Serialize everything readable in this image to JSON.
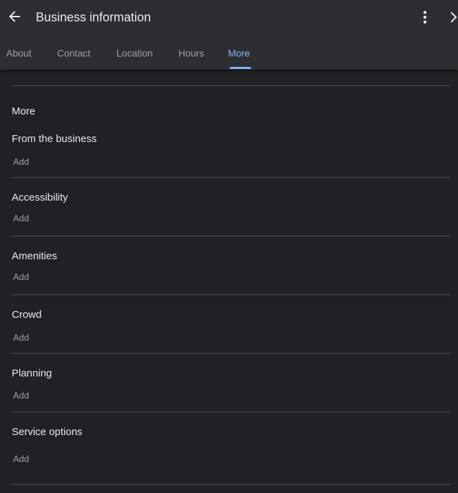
{
  "header": {
    "title": "Business information",
    "back_icon": "arrow-left-icon",
    "menu_icon": "more-vert-icon",
    "next_icon": "chevron-right-icon"
  },
  "tabs": [
    {
      "label": "About"
    },
    {
      "label": "Contact"
    },
    {
      "label": "Location"
    },
    {
      "label": "Hours"
    },
    {
      "label": "More",
      "active": true
    }
  ],
  "section": {
    "heading": "More",
    "rows": [
      {
        "title": "From the business",
        "action": "Add"
      },
      {
        "title": "Accessibility",
        "action": "Add"
      },
      {
        "title": "Amenities",
        "action": "Add"
      },
      {
        "title": "Crowd",
        "action": "Add"
      },
      {
        "title": "Planning",
        "action": "Add"
      },
      {
        "title": "Service options",
        "action": "Add"
      }
    ]
  },
  "colors": {
    "background": "#202124",
    "header": "#2d2e31",
    "accent": "#8ab4f8",
    "text_primary": "#e8eaed",
    "text_secondary": "#9aa0a6",
    "divider": "#4a4c50"
  }
}
